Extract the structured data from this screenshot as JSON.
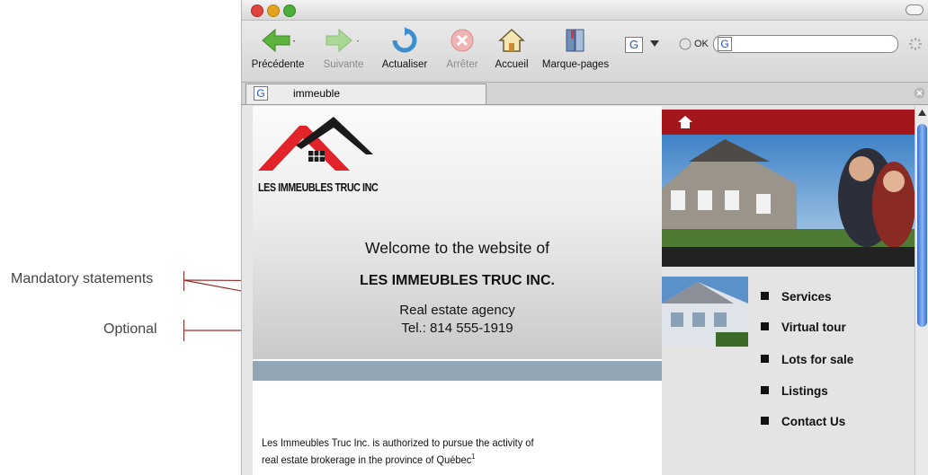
{
  "annotations": {
    "mandatory": "Mandatory statements",
    "optional": "Optional"
  },
  "browser": {
    "toolbar": {
      "back": "Précédente",
      "forward": "Suivante",
      "reload": "Actualiser",
      "stop": "Arrêter",
      "home": "Accueil",
      "bookmarks": "Marque-pages",
      "ok": "OK"
    },
    "tab_title": "immeuble"
  },
  "site": {
    "logo_text": "LES IMMEUBLES TRUC INC",
    "welcome": "Welcome to the website of",
    "company": "LES IMMEUBLES TRUC INC.",
    "agency": "Real estate agency",
    "tel": "Tel.: 814 555-1919",
    "body_line1": "Les Immeubles Truc Inc. is authorized to pursue the activity of",
    "body_line2": "real estate brokerage in the province of Québec",
    "footnote": "1",
    "menu": [
      "Services",
      "Virtual tour",
      "Lots for sale",
      "Listings",
      "Contact Us"
    ]
  },
  "colors": {
    "accent_red": "#a3161b",
    "band_blue": "#93a6b5"
  }
}
